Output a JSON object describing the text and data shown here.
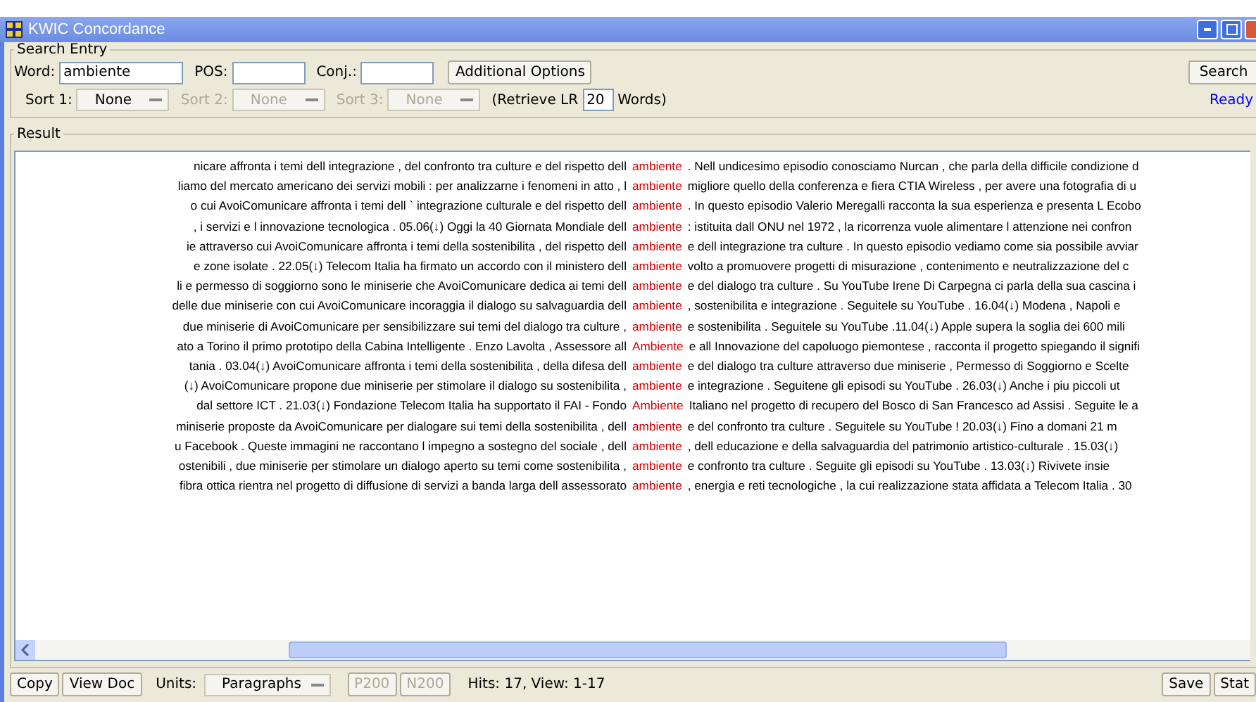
{
  "window": {
    "title": "KWIC Concordance"
  },
  "search_entry": {
    "legend": "Search Entry",
    "word": {
      "label": "Word:",
      "value": "ambiente"
    },
    "pos": {
      "label": "POS:"
    },
    "conj": {
      "label": "Conj.:"
    },
    "additional_options": "Additional Options",
    "search_button": "Search",
    "sorts": [
      {
        "label": "Sort 1:",
        "value": "None",
        "disabled": false
      },
      {
        "label": "Sort 2:",
        "value": "None",
        "disabled": true
      },
      {
        "label": "Sort 3:",
        "value": "None",
        "disabled": true
      }
    ],
    "retrieve": {
      "prefix": "(Retrieve LR",
      "value": "20",
      "suffix": "Words)"
    },
    "status": "Ready"
  },
  "result": {
    "legend": "Result",
    "rows": [
      {
        "left": "nicare affronta i temi dell integrazione , del confronto tra culture e del rispetto dell",
        "keyword": "ambiente",
        "right": ". Nell undicesimo episodio conosciamo Nurcan , che parla della difficile condizione d"
      },
      {
        "left": "liamo del mercato americano dei servizi mobili : per analizzarne i fenomeni in atto , l",
        "keyword": "ambiente",
        "right": "migliore quello della conferenza e fiera CTIA Wireless , per avere una fotografia di u"
      },
      {
        "left": "o cui AvoiComunicare affronta i temi dell ` integrazione culturale e del rispetto dell",
        "keyword": "ambiente",
        "right": ". In questo episodio Valerio Meregalli racconta la sua esperienza e presenta L Ecobo"
      },
      {
        "left": ", i servizi e l innovazione tecnologica . 05.06(↓) Oggi la 40 Giornata Mondiale dell",
        "keyword": "ambiente",
        "right": ": istituita dall ONU nel 1972 , la ricorrenza vuole alimentare l attenzione nei confron"
      },
      {
        "left": "ie attraverso cui AvoiComunicare affronta i temi della sostenibilita , del rispetto dell",
        "keyword": "ambiente",
        "right": "e dell integrazione tra culture . In questo episodio vediamo come sia possibile avviar"
      },
      {
        "left": "e zone isolate . 22.05(↓) Telecom Italia ha firmato un accordo con il ministero dell",
        "keyword": "ambiente",
        "right": "volto a promuovere progetti di misurazione , contenimento e neutralizzazione del c"
      },
      {
        "left": "li e permesso di soggiorno sono le miniserie che AvoiComunicare dedica ai temi dell",
        "keyword": "ambiente",
        "right": "e del dialogo tra culture . Su YouTube Irene Di Carpegna ci parla della sua cascina i"
      },
      {
        "left": "delle due miniserie con cui AvoiComunicare incoraggia il dialogo su salvaguardia dell",
        "keyword": "ambiente",
        "right": ", sostenibilita e integrazione . Seguitele su YouTube . 16.04(↓) Modena , Napoli e"
      },
      {
        "left": "due miniserie di AvoiComunicare per sensibilizzare sui temi del dialogo tra culture ,",
        "keyword": "ambiente",
        "right": "e sostenibilita . Seguitele su YouTube .11.04(↓) Apple supera la soglia dei 600 mili"
      },
      {
        "left": "ato a Torino il primo prototipo della Cabina Intelligente . Enzo Lavolta , Assessore all",
        "keyword": "Ambiente",
        "right": "e all Innovazione del capoluogo piemontese , racconta il progetto spiegando il signifi"
      },
      {
        "left": "tania . 03.04(↓) AvoiComunicare affronta i temi della sostenibilita , della difesa dell",
        "keyword": "ambiente",
        "right": "e del dialogo tra culture attraverso due miniserie , Permesso di Soggiorno e Scelte"
      },
      {
        "left": "(↓) AvoiComunicare propone due miniserie per stimolare il dialogo su sostenibilita ,",
        "keyword": "ambiente",
        "right": "e integrazione . Seguitene gli episodi su YouTube . 26.03(↓) Anche i piu piccoli ut"
      },
      {
        "left": "dal settore ICT . 21.03(↓) Fondazione Telecom Italia ha supportato il FAI - Fondo",
        "keyword": "Ambiente",
        "right": "Italiano nel progetto di recupero del Bosco di San Francesco ad Assisi . Seguite le a"
      },
      {
        "left": "miniserie proposte da AvoiComunicare per dialogare sui temi della sostenibilita , dell",
        "keyword": "ambiente",
        "right": "e del confronto tra culture . Seguitele su YouTube ! 20.03(↓) Fino a domani 21 m"
      },
      {
        "left": "u Facebook . Queste immagini ne raccontano l impegno a sostegno del sociale , dell",
        "keyword": "ambiente",
        "right": ", dell educazione e della salvaguardia del patrimonio artistico-culturale . 15.03(↓)"
      },
      {
        "left": "ostenibili , due miniserie per stimolare un dialogo aperto su temi come sostenibilita ,",
        "keyword": "ambiente",
        "right": "e confronto tra culture . Seguite gli episodi su YouTube . 13.03(↓) Rivivete insie"
      },
      {
        "left": "fibra ottica rientra nel progetto di diffusione di servizi a banda larga dell assessorato",
        "keyword": "ambiente",
        "right": ", energia e reti tecnologiche , la cui realizzazione stata affidata a Telecom Italia . 30"
      }
    ]
  },
  "bottom_bar": {
    "copy": "Copy",
    "view_doc": "View Doc",
    "units_label": "Units:",
    "units_value": "Paragraphs",
    "pager": [
      {
        "label": "P200",
        "disabled": true
      },
      {
        "label": "N200",
        "disabled": true
      }
    ],
    "hits": "Hits: 17, View: 1-17",
    "save": "Save",
    "stats": "Stat"
  }
}
